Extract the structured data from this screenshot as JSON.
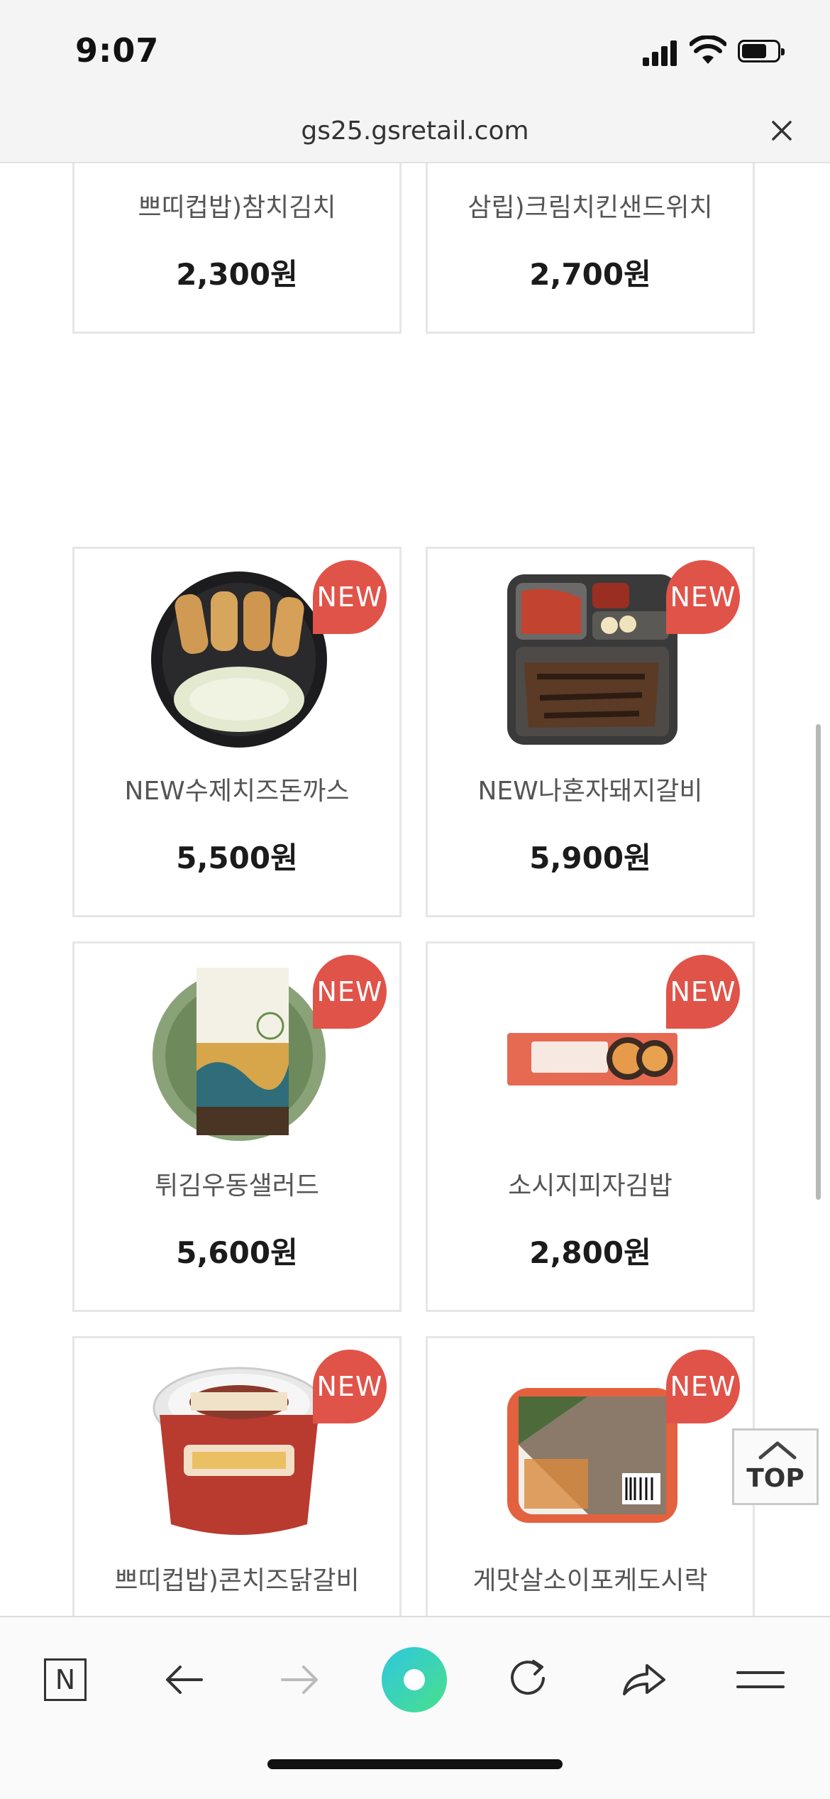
{
  "status": {
    "time": "9:07"
  },
  "browser": {
    "url": "gs25.gsretail.com"
  },
  "badge_text": "NEW",
  "products": [
    {
      "name": "쁘띠컵밥)참치김치",
      "price": "2,300원"
    },
    {
      "name": "삼립)크림치킨샌드위치",
      "price": "2,700원"
    },
    {
      "name": "NEW수제치즈돈까스",
      "price": "5,500원"
    },
    {
      "name": "NEW나혼자돼지갈비",
      "price": "5,900원"
    },
    {
      "name": "튀김우동샐러드",
      "price": "5,600원"
    },
    {
      "name": "소시지피자김밥",
      "price": "2,800원"
    },
    {
      "name": "쁘띠컵밥)콘치즈닭갈비",
      "price": ""
    },
    {
      "name": "게맛살소이포케도시락",
      "price": ""
    }
  ],
  "top_button": {
    "label": "TOP"
  },
  "toolbar": {
    "icons": [
      "naver-icon",
      "back-icon",
      "forward-icon",
      "green-dot-icon",
      "reload-icon",
      "share-icon",
      "menu-icon"
    ],
    "naver_label": "N"
  },
  "colors": {
    "badge": "#e05349",
    "accent_green": "#3fd3a0"
  }
}
